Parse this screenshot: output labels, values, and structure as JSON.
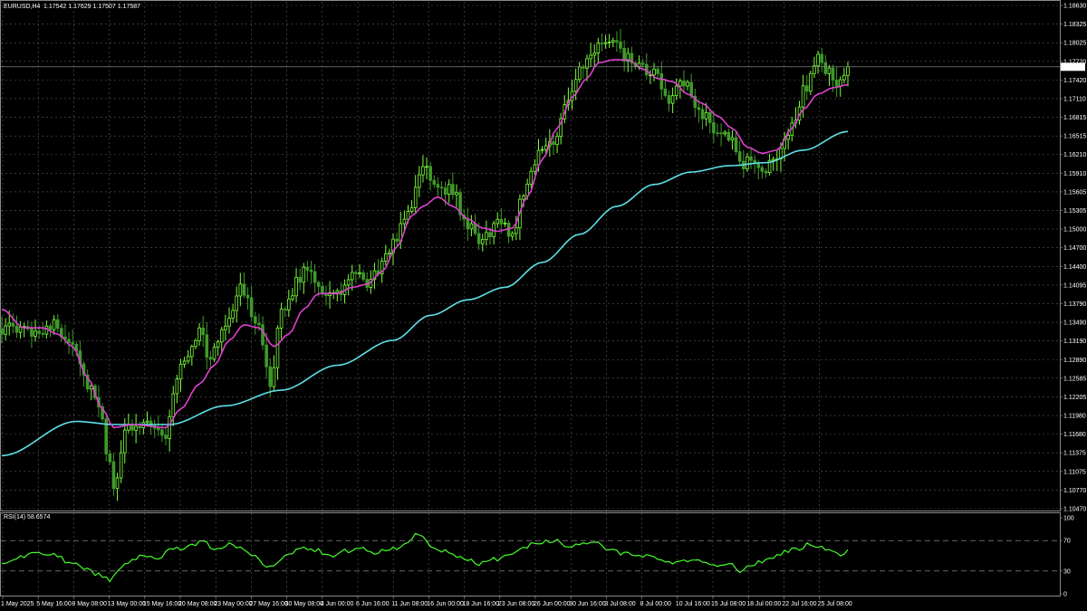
{
  "header": {
    "symbol_tf": "EURUSD,H4",
    "ohlc": "1.17542 1.17629 1.17507 1.17587"
  },
  "rsi_header": "RSI(14) 58.6574",
  "current_price_label": "1.17587",
  "colors": {
    "background": "#000000",
    "grid": "#5a5a5a",
    "axis": "#8a8a8a",
    "bull_candle": "#7dff3a",
    "bear_candle": "#3e9a2a",
    "ma_fast": "#e040d0",
    "ma_slow": "#5ee0e8",
    "rsi_line": "#44ff2a",
    "text": "#ffffff",
    "price_tag_bg": "#ffffff",
    "price_tag_text": "#000000"
  },
  "chart_data": [
    {
      "type": "candlestick",
      "title": "EURUSD,H4",
      "ylim": [
        1.1047,
        1.1863
      ],
      "price_ticks": [
        "1.18630",
        "1.18325",
        "1.18025",
        "1.17720",
        "1.17420",
        "1.17110",
        "1.16815",
        "1.16515",
        "1.16210",
        "1.15910",
        "1.15605",
        "1.15305",
        "1.15000",
        "1.14700",
        "1.14400",
        "1.14095",
        "1.13790",
        "1.13490",
        "1.13190",
        "1.12890",
        "1.12585",
        "1.12205",
        "1.11980",
        "1.11680",
        "1.11375",
        "1.11075",
        "1.10770",
        "1.10470"
      ],
      "time_ticks": [
        "1 May 2025",
        "5 May 16:00",
        "8 May 08:00",
        "13 May 00:00",
        "15 May 16:00",
        "20 May 08:00",
        "23 May 00:00",
        "27 May 16:00",
        "30 May 08:00",
        "4 Jun 00:00",
        "6 Jun 16:00",
        "11 Jun 08:00",
        "16 Jun 00:00",
        "18 Jun 16:00",
        "23 Jun 08:00",
        "26 Jun 00:00",
        "30 Jun 16:00",
        "3 Jul 08:00",
        "8 Jul 00:00",
        "10 Jul 16:00",
        "15 Jul 08:00",
        "18 Jul 00:00",
        "22 Jul 16:00",
        "25 Jul 08:00"
      ],
      "last_price": 1.17587,
      "price_anchors": [
        [
          0,
          1.134
        ],
        [
          4,
          1.1335
        ],
        [
          9,
          1.1335
        ],
        [
          13,
          1.1345
        ],
        [
          19,
          1.132
        ],
        [
          23,
          1.125
        ],
        [
          27,
          1.1195
        ],
        [
          28,
          1.114
        ],
        [
          30,
          1.109
        ],
        [
          34,
          1.118
        ],
        [
          38,
          1.119
        ],
        [
          41,
          1.1185
        ],
        [
          44,
          1.116
        ],
        [
          46,
          1.124
        ],
        [
          49,
          1.129
        ],
        [
          53,
          1.1335
        ],
        [
          56,
          1.129
        ],
        [
          60,
          1.135
        ],
        [
          64,
          1.14
        ],
        [
          69,
          1.135
        ],
        [
          72,
          1.124
        ],
        [
          75,
          1.136
        ],
        [
          79,
          1.141
        ],
        [
          82,
          1.144
        ],
        [
          86,
          1.14
        ],
        [
          90,
          1.139
        ],
        [
          94,
          1.1425
        ],
        [
          98,
          1.141
        ],
        [
          102,
          1.144
        ],
        [
          106,
          1.149
        ],
        [
          110,
          1.154
        ],
        [
          113,
          1.16
        ],
        [
          117,
          1.157
        ],
        [
          121,
          1.156
        ],
        [
          125,
          1.15
        ],
        [
          129,
          1.148
        ],
        [
          133,
          1.151
        ],
        [
          137,
          1.149
        ],
        [
          140,
          1.156
        ],
        [
          144,
          1.162
        ],
        [
          148,
          1.164
        ],
        [
          151,
          1.17
        ],
        [
          155,
          1.175
        ],
        [
          158,
          1.177
        ],
        [
          161,
          1.18
        ],
        [
          164,
          1.1795
        ],
        [
          167,
          1.1775
        ],
        [
          171,
          1.1755
        ],
        [
          175,
          1.1745
        ],
        [
          179,
          1.171
        ],
        [
          183,
          1.173
        ],
        [
          187,
          1.169
        ],
        [
          191,
          1.166
        ],
        [
          195,
          1.165
        ],
        [
          198,
          1.16
        ],
        [
          202,
          1.161
        ],
        [
          205,
          1.159
        ],
        [
          208,
          1.162
        ],
        [
          212,
          1.166
        ],
        [
          215,
          1.172
        ],
        [
          219,
          1.177
        ],
        [
          222,
          1.175
        ],
        [
          225,
          1.173
        ],
        [
          227,
          1.1759
        ]
      ],
      "series": [
        {
          "name": "",
          "kind": "ma_fast",
          "anchors": [
            [
              0,
              1.137
            ],
            [
              6,
              1.134
            ],
            [
              11,
              1.134
            ],
            [
              15,
              1.133
            ],
            [
              19,
              1.131
            ],
            [
              23,
              1.126
            ],
            [
              27,
              1.121
            ],
            [
              30,
              1.118
            ],
            [
              35,
              1.1185
            ],
            [
              44,
              1.118
            ],
            [
              48,
              1.121
            ],
            [
              53,
              1.125
            ],
            [
              57,
              1.128
            ],
            [
              61,
              1.132
            ],
            [
              65,
              1.1345
            ],
            [
              69,
              1.134
            ],
            [
              73,
              1.131
            ],
            [
              77,
              1.133
            ],
            [
              81,
              1.137
            ],
            [
              85,
              1.1395
            ],
            [
              90,
              1.1395
            ],
            [
              94,
              1.1405
            ],
            [
              98,
              1.141
            ],
            [
              102,
              1.143
            ],
            [
              106,
              1.147
            ],
            [
              110,
              1.152
            ],
            [
              113,
              1.1535
            ],
            [
              117,
              1.155
            ],
            [
              121,
              1.1535
            ],
            [
              125,
              1.1515
            ],
            [
              129,
              1.15
            ],
            [
              133,
              1.1495
            ],
            [
              137,
              1.15
            ],
            [
              141,
              1.155
            ],
            [
              145,
              1.161
            ],
            [
              149,
              1.166
            ],
            [
              153,
              1.171
            ],
            [
              157,
              1.174
            ],
            [
              160,
              1.1765
            ],
            [
              164,
              1.177
            ],
            [
              168,
              1.177
            ],
            [
              172,
              1.1755
            ],
            [
              176,
              1.174
            ],
            [
              180,
              1.1735
            ],
            [
              184,
              1.1715
            ],
            [
              188,
              1.17
            ],
            [
              192,
              1.168
            ],
            [
              196,
              1.166
            ],
            [
              200,
              1.163
            ],
            [
              204,
              1.162
            ],
            [
              208,
              1.1625
            ],
            [
              212,
              1.166
            ],
            [
              215,
              1.169
            ],
            [
              219,
              1.1715
            ],
            [
              223,
              1.1725
            ],
            [
              227,
              1.173
            ]
          ]
        },
        {
          "name": "",
          "kind": "ma_slow",
          "anchors": [
            [
              0,
              1.1135
            ],
            [
              20,
              1.119
            ],
            [
              30,
              1.1185
            ],
            [
              45,
              1.1185
            ],
            [
              60,
              1.1215
            ],
            [
              75,
              1.124
            ],
            [
              90,
              1.128
            ],
            [
              105,
              1.132
            ],
            [
              115,
              1.136
            ],
            [
              125,
              1.1385
            ],
            [
              135,
              1.1405
            ],
            [
              145,
              1.1445
            ],
            [
              155,
              1.149
            ],
            [
              165,
              1.1535
            ],
            [
              175,
              1.157
            ],
            [
              185,
              1.159
            ],
            [
              195,
              1.16
            ],
            [
              205,
              1.1605
            ],
            [
              215,
              1.1625
            ],
            [
              227,
              1.1655
            ]
          ]
        }
      ]
    },
    {
      "type": "line",
      "title": "RSI(14) 58.6574",
      "ylim": [
        0,
        100
      ],
      "y_ticks": [
        "100",
        "70",
        "30",
        "0"
      ],
      "levels": [
        70,
        30
      ],
      "series": [
        {
          "name": "",
          "anchors": [
            [
              0,
              38
            ],
            [
              5,
              48
            ],
            [
              10,
              55
            ],
            [
              14,
              52
            ],
            [
              18,
              42
            ],
            [
              22,
              35
            ],
            [
              26,
              25
            ],
            [
              29,
              18
            ],
            [
              33,
              40
            ],
            [
              38,
              52
            ],
            [
              42,
              48
            ],
            [
              46,
              58
            ],
            [
              50,
              62
            ],
            [
              54,
              68
            ],
            [
              57,
              58
            ],
            [
              61,
              66
            ],
            [
              64,
              62
            ],
            [
              68,
              48
            ],
            [
              72,
              35
            ],
            [
              76,
              50
            ],
            [
              80,
              60
            ],
            [
              84,
              58
            ],
            [
              88,
              50
            ],
            [
              92,
              56
            ],
            [
              96,
              60
            ],
            [
              100,
              55
            ],
            [
              104,
              58
            ],
            [
              108,
              64
            ],
            [
              112,
              80
            ],
            [
              116,
              60
            ],
            [
              120,
              54
            ],
            [
              124,
              46
            ],
            [
              128,
              40
            ],
            [
              132,
              45
            ],
            [
              136,
              50
            ],
            [
              140,
              62
            ],
            [
              144,
              68
            ],
            [
              148,
              70
            ],
            [
              152,
              62
            ],
            [
              156,
              68
            ],
            [
              160,
              66
            ],
            [
              164,
              56
            ],
            [
              168,
              52
            ],
            [
              172,
              50
            ],
            [
              176,
              45
            ],
            [
              180,
              40
            ],
            [
              184,
              44
            ],
            [
              188,
              42
            ],
            [
              192,
              35
            ],
            [
              196,
              40
            ],
            [
              198,
              30
            ],
            [
              202,
              40
            ],
            [
              206,
              45
            ],
            [
              210,
              55
            ],
            [
              214,
              60
            ],
            [
              217,
              66
            ],
            [
              220,
              62
            ],
            [
              223,
              56
            ],
            [
              225,
              50
            ],
            [
              227,
              58
            ]
          ]
        }
      ]
    }
  ]
}
